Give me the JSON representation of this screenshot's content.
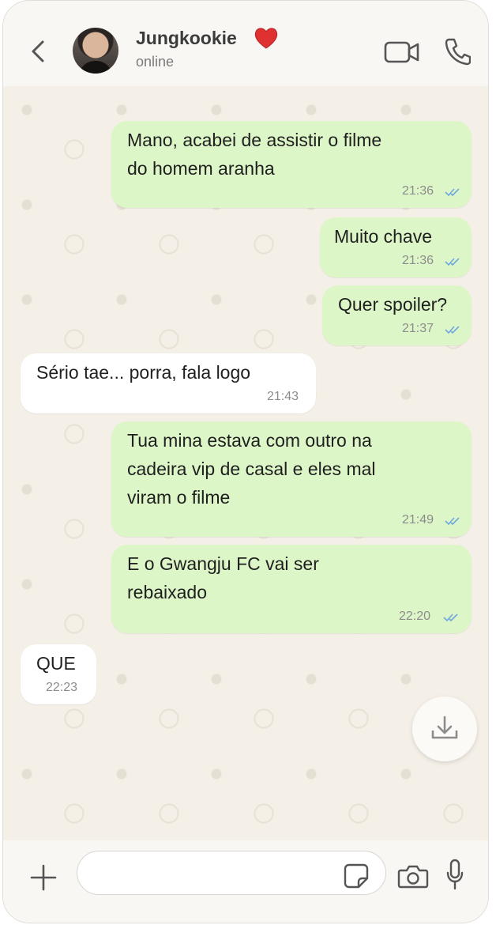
{
  "header": {
    "contact_name": "Jungkookie",
    "status": "online",
    "heart_icon": "red-heart-emoji",
    "back_icon": "chevron-left-icon",
    "video_icon": "video-camera-icon",
    "call_icon": "phone-icon"
  },
  "messages": [
    {
      "direction": "out",
      "text": "Mano, acabei de assistir o filme\ndo homem aranha",
      "time": "21:36",
      "read": true
    },
    {
      "direction": "out",
      "text": "Muito chave",
      "time": "21:36",
      "read": true
    },
    {
      "direction": "out",
      "text": "Quer spoiler?",
      "time": "21:37",
      "read": true
    },
    {
      "direction": "in",
      "text": "Sério tae... porra, fala logo",
      "time": "21:43"
    },
    {
      "direction": "out",
      "text": "Tua mina estava com outro na\ncadeira vip de casal e eles mal\nviram o filme",
      "time": "21:49",
      "read": true
    },
    {
      "direction": "out",
      "text": "E o Gwangju FC vai ser\nrebaixado",
      "time": "22:20",
      "read": true
    },
    {
      "direction": "in",
      "text": "QUE",
      "time": "22:23"
    }
  ],
  "scroll_button": {
    "icon": "download-arrow-icon"
  },
  "composer": {
    "placeholder": "",
    "value": "",
    "plus_icon": "plus-icon",
    "sticker_icon": "sticker-icon",
    "camera_icon": "camera-icon",
    "mic_icon": "microphone-icon"
  },
  "colors": {
    "outgoing_bubble": "#ddf6c8",
    "incoming_bubble": "#ffffff",
    "read_ticks": "#6fa8dc",
    "heart": "#e03131"
  }
}
